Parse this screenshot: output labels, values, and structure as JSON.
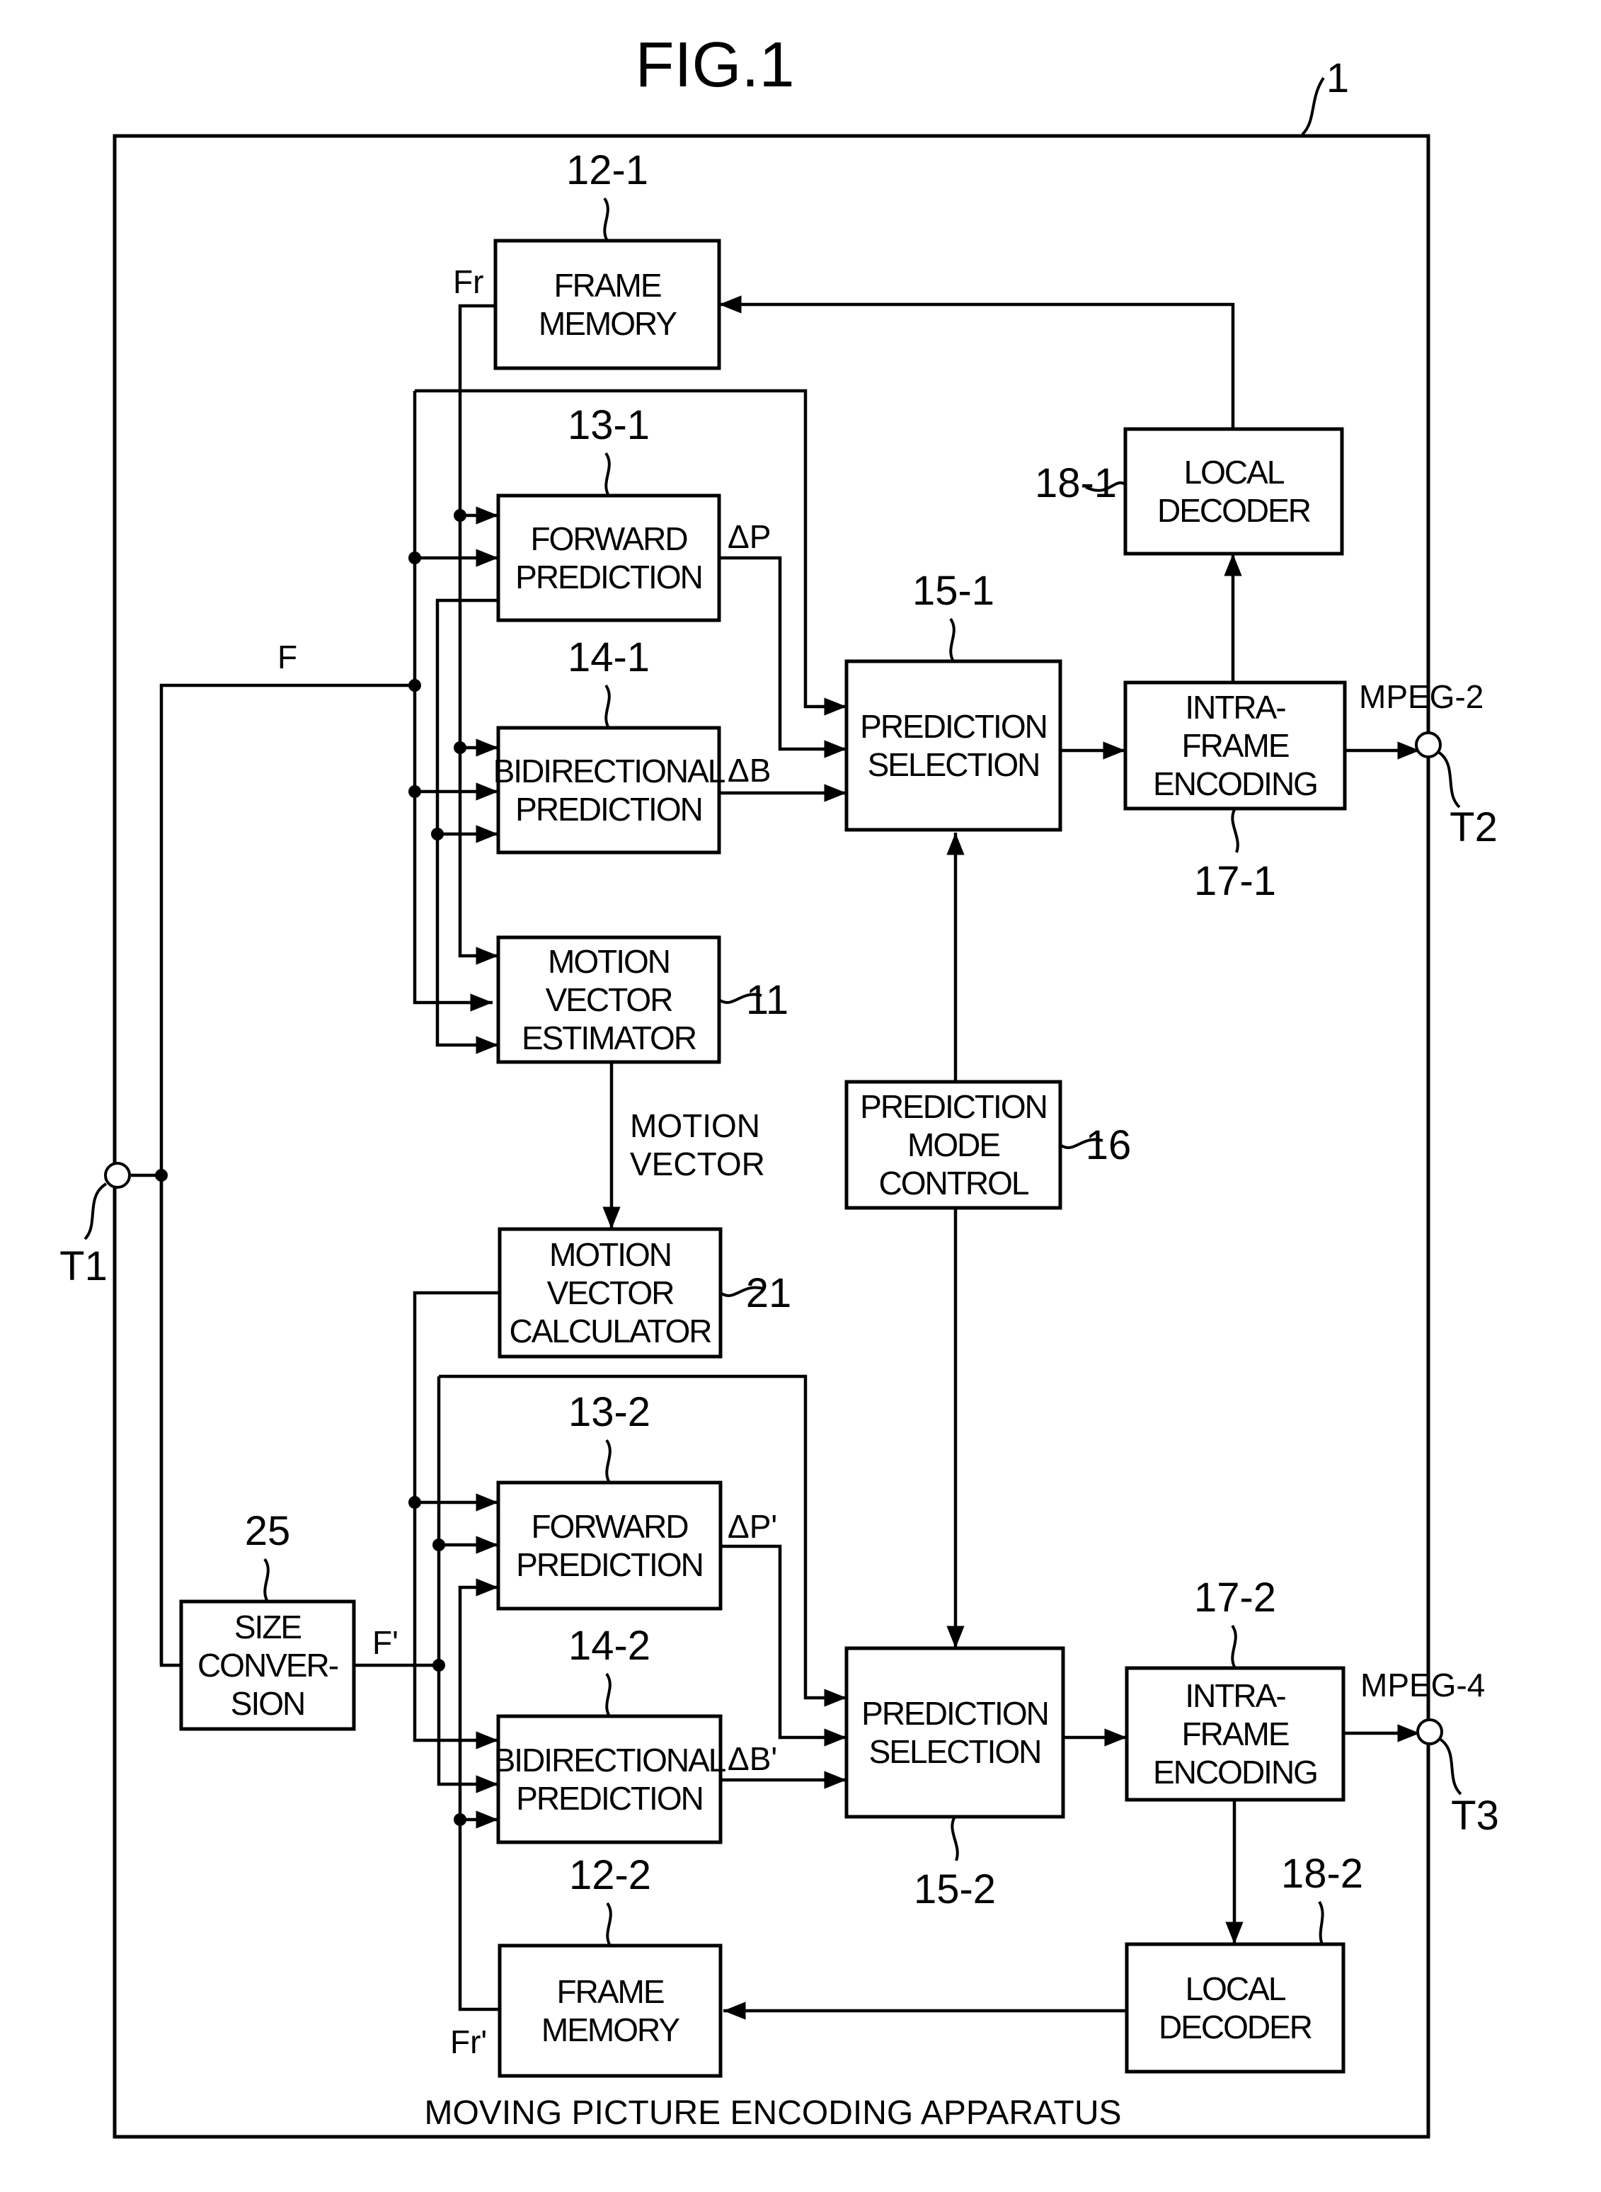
{
  "figure": {
    "title": "FIG.1",
    "apparatus_ref": "1",
    "caption": "MOVING PICTURE ENCODING APPARATUS"
  },
  "blocks": {
    "frame_memory_1": {
      "ref": "12-1",
      "lines": [
        "FRAME",
        "MEMORY"
      ]
    },
    "forward_prediction_1": {
      "ref": "13-1",
      "lines": [
        "FORWARD",
        "PREDICTION"
      ]
    },
    "bidirectional_prediction_1": {
      "ref": "14-1",
      "lines": [
        "BIDIRECTIONAL",
        "PREDICTION"
      ]
    },
    "motion_vector_estimator": {
      "ref": "11",
      "lines": [
        "MOTION",
        "VECTOR",
        "ESTIMATOR"
      ]
    },
    "prediction_selection_1": {
      "ref": "15-1",
      "lines": [
        "PREDICTION",
        "SELECTION"
      ]
    },
    "local_decoder_1": {
      "ref": "18-1",
      "lines": [
        "LOCAL",
        "DECODER"
      ]
    },
    "intra_frame_encoding_1": {
      "ref": "17-1",
      "lines": [
        "INTRA-",
        "FRAME",
        "ENCODING"
      ]
    },
    "prediction_mode_control": {
      "ref": "16",
      "lines": [
        "PREDICTION",
        "MODE",
        "CONTROL"
      ]
    },
    "motion_vector_calculator": {
      "ref": "21",
      "lines": [
        "MOTION",
        "VECTOR",
        "CALCULATOR"
      ]
    },
    "forward_prediction_2": {
      "ref": "13-2",
      "lines": [
        "FORWARD",
        "PREDICTION"
      ]
    },
    "bidirectional_prediction_2": {
      "ref": "14-2",
      "lines": [
        "BIDIRECTIONAL",
        "PREDICTION"
      ]
    },
    "size_conversion": {
      "ref": "25",
      "lines": [
        "SIZE",
        "CONVER-",
        "SION"
      ]
    },
    "prediction_selection_2": {
      "ref": "15-2",
      "lines": [
        "PREDICTION",
        "SELECTION"
      ]
    },
    "intra_frame_encoding_2": {
      "ref": "17-2",
      "lines": [
        "INTRA-",
        "FRAME",
        "ENCODING"
      ]
    },
    "local_decoder_2": {
      "ref": "18-2",
      "lines": [
        "LOCAL",
        "DECODER"
      ]
    },
    "frame_memory_2": {
      "ref": "12-2",
      "lines": [
        "FRAME",
        "MEMORY"
      ]
    }
  },
  "signals": {
    "F": "F",
    "Fr": "Fr",
    "F_prime": "F'",
    "Fr_prime": "Fr'",
    "delta_P": "ΔP",
    "delta_B": "ΔB",
    "delta_P_prime": "ΔP'",
    "delta_B_prime": "ΔB'",
    "motion_vector_line1": "MOTION",
    "motion_vector_line2": "VECTOR"
  },
  "terminals": {
    "T1": {
      "label": "T1"
    },
    "T2": {
      "label": "T2",
      "format": "MPEG-2"
    },
    "T3": {
      "label": "T3",
      "format": "MPEG-4"
    }
  }
}
